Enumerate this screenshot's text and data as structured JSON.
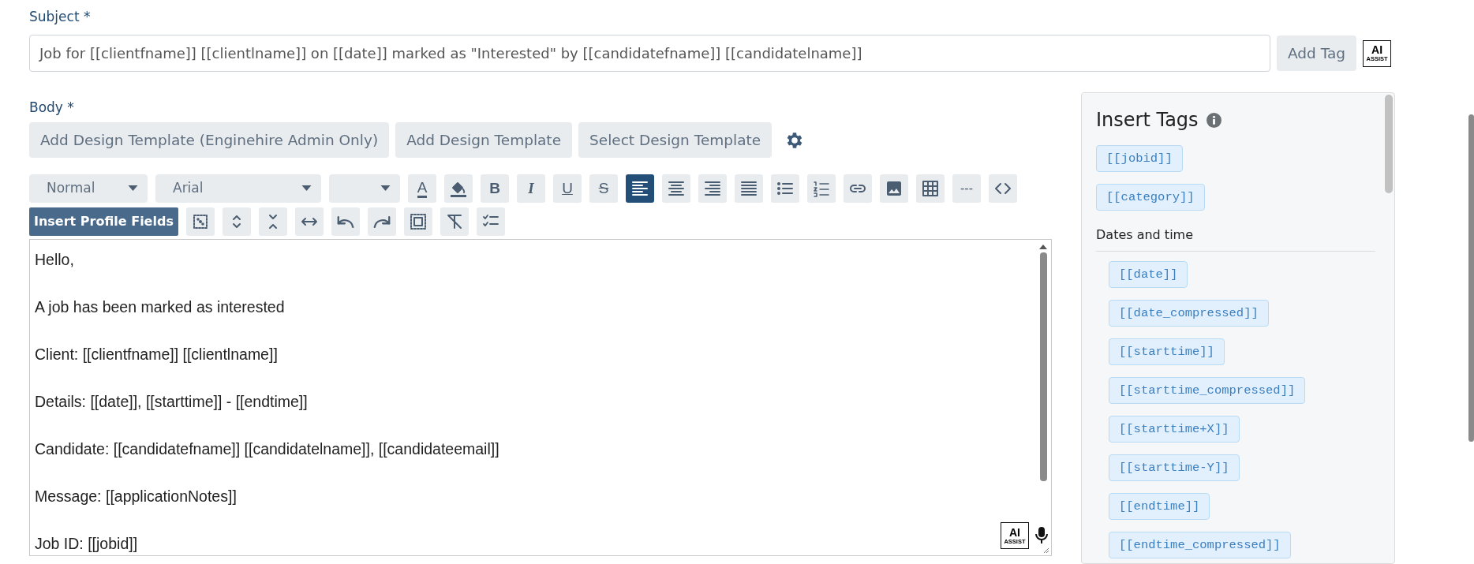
{
  "subject": {
    "label": "Subject *",
    "value": "Job for [[clientfname]] [[clientlname]] on [[date]] marked as \"Interested\" by [[candidatefname]] [[candidatelname]]",
    "add_tag": "Add Tag",
    "ai_logo": {
      "title": "AI",
      "subtitle": "ASSIST"
    }
  },
  "body": {
    "label": "Body *",
    "template_buttons": [
      "Add Design Template (Enginehire Admin Only)",
      "Add Design Template",
      "Select Design Template"
    ],
    "toolbar_rows": [
      [
        {
          "kind": "select",
          "value": "Normal"
        },
        {
          "kind": "select",
          "value": "Arial"
        },
        {
          "kind": "select"
        },
        {
          "kind": "button",
          "label": "A",
          "selected": false
        },
        {
          "kind": "button",
          "selected": false
        },
        {
          "kind": "button",
          "label": "B",
          "selected": false
        },
        {
          "kind": "button",
          "label": "I",
          "selected": false
        },
        {
          "kind": "button",
          "label": "U",
          "selected": false
        },
        {
          "kind": "button",
          "label": "S",
          "selected": false
        },
        {
          "kind": "button",
          "selected": true
        },
        {
          "kind": "button",
          "selected": false
        },
        {
          "kind": "button",
          "selected": false
        },
        {
          "kind": "button",
          "selected": false
        },
        {
          "kind": "button",
          "selected": false
        },
        {
          "kind": "button",
          "selected": false
        },
        {
          "kind": "button",
          "selected": false
        },
        {
          "kind": "button",
          "selected": false
        },
        {
          "kind": "button",
          "selected": false
        },
        {
          "kind": "button",
          "label": "---",
          "selected": false
        },
        {
          "kind": "button",
          "selected": false
        }
      ],
      [
        {
          "kind": "action",
          "label": "Insert Profile Fields"
        },
        {
          "kind": "button",
          "selected": false
        },
        {
          "kind": "button",
          "selected": false
        },
        {
          "kind": "button",
          "selected": false
        },
        {
          "kind": "button",
          "selected": false
        },
        {
          "kind": "button",
          "selected": false
        },
        {
          "kind": "button",
          "selected": false
        },
        {
          "kind": "button",
          "selected": false
        },
        {
          "kind": "button",
          "selected": false
        },
        {
          "kind": "button",
          "selected": false
        }
      ]
    ],
    "editor": {
      "paragraphs": [
        "Hello,",
        "A job has been marked as interested",
        "Client: [[clientfname]] [[clientlname]]",
        "Details: [[date]], [[starttime]] - [[endtime]]",
        "Candidate: [[candidatefname]] [[candidatelname]], [[candidateemail]]",
        "Message: [[applicationNotes]]",
        "Job ID: [[jobid]]"
      ],
      "ai_logo": {
        "title": "AI",
        "subtitle": "ASSIST"
      }
    }
  },
  "tags_panel": {
    "title": "Insert Tags",
    "tags": [
      "[[jobid]]",
      "[[category]]"
    ],
    "sections": [
      {
        "title": "Dates and time",
        "tags": [
          "[[date]]",
          "[[date_compressed]]",
          "[[starttime]]",
          "[[starttime_compressed]]",
          "[[starttime+X]]",
          "[[starttime-Y]]",
          "[[endtime]]",
          "[[endtime_compressed]]"
        ]
      }
    ]
  }
}
